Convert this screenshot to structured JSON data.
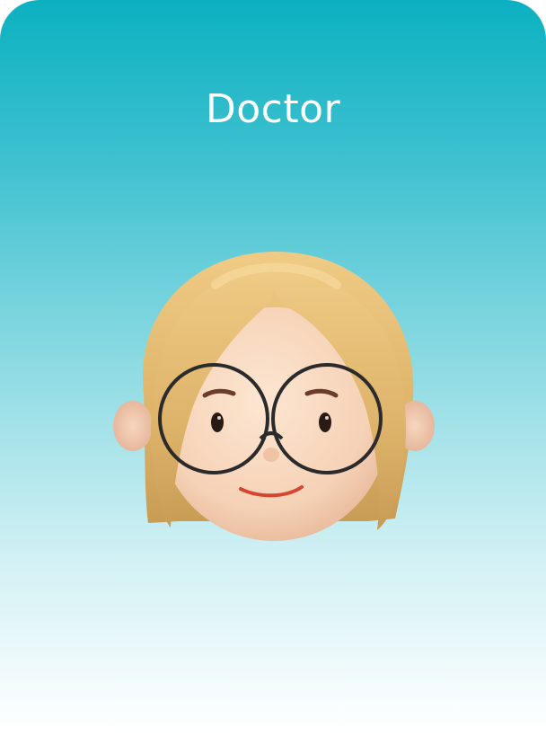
{
  "card": {
    "title": "Doctor"
  },
  "avatar": {
    "icon": "doctor-avatar-icon",
    "description_hidden": true
  },
  "colors": {
    "gradient_top": "#0bb1c1",
    "gradient_bottom": "#ffffff",
    "title_text": "#ffffff",
    "hair": "#e2b96f",
    "skin": "#f7d6bd"
  }
}
